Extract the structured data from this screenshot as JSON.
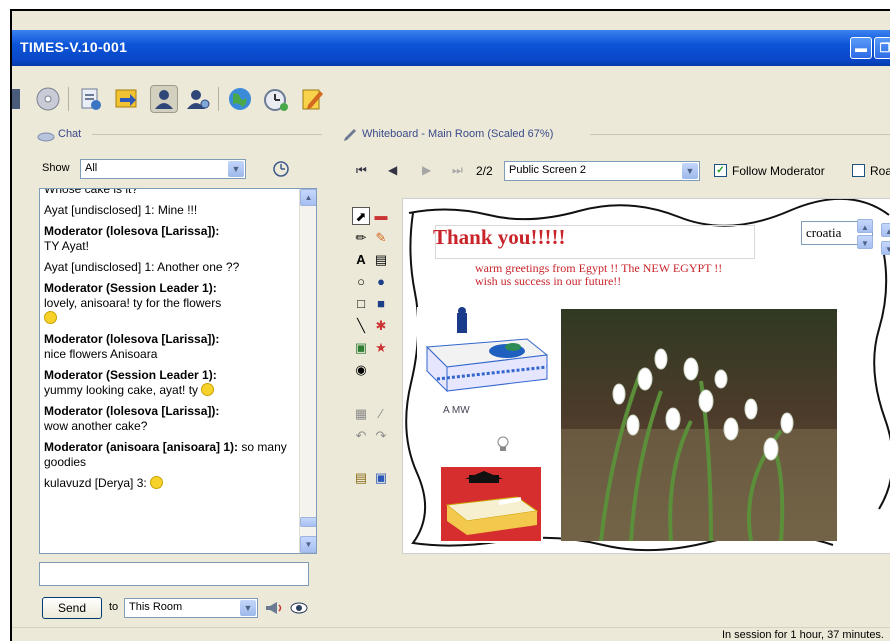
{
  "window": {
    "title": "TIMES-V.10-001"
  },
  "toolbar": {
    "icons": [
      "contacts-icon",
      "cd-icon",
      "document-icon",
      "arrow-share-icon",
      "user-icon",
      "webcam-user-icon",
      "globe-icon",
      "timer-icon",
      "notepad-icon"
    ]
  },
  "chat": {
    "panel_title": "Chat",
    "show_label": "Show",
    "show_value": "All",
    "messages": [
      {
        "sender": "",
        "text": "Whose cake is it?"
      },
      {
        "sender": "",
        "text": "Ayat [undisclosed] 1: Mine !!!"
      },
      {
        "sender": "Moderator (lolesova [Larissa]):",
        "text": "TY Ayat!"
      },
      {
        "sender": "",
        "text": "Ayat [undisclosed] 1: Another one ??"
      },
      {
        "sender": "Moderator (Session Leader 1):",
        "text": "lovely, anisoara! ty for the flowers"
      },
      {
        "sender": "Moderator (lolesova [Larissa]):",
        "text": "nice flowers Anisoara"
      },
      {
        "sender": "Moderator (Session Leader 1):",
        "text": "yummy looking cake, ayat! ty"
      },
      {
        "sender": "Moderator (lolesova [Larissa]):",
        "text": "wow another cake?"
      },
      {
        "sender": "Moderator (anisoara [anisoara] 1):",
        "text": "so many goodies"
      },
      {
        "sender": "",
        "text": "kulavuzd [Derya] 3:"
      }
    ],
    "input_value": "",
    "send_label": "Send",
    "to_label": "to",
    "to_value": "This Room"
  },
  "whiteboard": {
    "title": "Whiteboard - Main Room (Scaled 67%)",
    "page_indicator": "2/2",
    "screen_value": "Public Screen 2",
    "follow_moderator_label": "Follow Moderator",
    "follow_moderator_checked": true,
    "roam_label": "Roa",
    "canvas": {
      "heading": "Thank you!!!!!",
      "greeting_line1": "warm greetings from Egypt !! The NEW EGYPT !!",
      "greeting_line2": "wish us success in our future!!",
      "font_value": "croatia",
      "cake_caption": "A MW",
      "accent_color": "#c8242a"
    }
  },
  "status": {
    "session_text": "In session for 1 hour, 37 minutes."
  }
}
